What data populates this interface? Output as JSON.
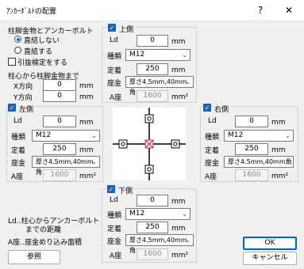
{
  "window": {
    "title": "ｱﾝｶｰﾎﾞﾙﾄの配置",
    "help": "?",
    "close": "✕"
  },
  "left_panel": {
    "column_title": "柱脚金物とアンカーボルト",
    "radio_no_connect": "直結しない",
    "radio_connect": "直結する",
    "pullout_label": "引抜検定をする",
    "distance_title": "柱心から柱脚金物まで",
    "x_label": "X方向",
    "x_value": "0",
    "x_unit": "mm",
    "y_label": "Y方向",
    "y_value": "0",
    "y_unit": "mm"
  },
  "groups": {
    "top": {
      "title": "上側",
      "ld": "0",
      "type": "M12",
      "fix": "250",
      "washer": "厚さ4.5mm,40mm角",
      "area": "1600"
    },
    "left": {
      "title": "左側",
      "ld": "0",
      "type": "M12",
      "fix": "250",
      "washer": "厚さ4.5mm,40mm角",
      "area": "1600"
    },
    "right": {
      "title": "右側",
      "ld": "0",
      "type": "M12",
      "fix": "250",
      "washer": "厚さ4.5mm,40mm角",
      "area": "1600"
    },
    "bottom": {
      "title": "下側",
      "ld": "0",
      "type": "M12",
      "fix": "250",
      "washer": "厚さ4.5mm,40mm角",
      "area": "1600"
    }
  },
  "labels": {
    "ld": "Ld",
    "type": "種類",
    "fix": "定着",
    "washer": "座金",
    "area": "A座",
    "mm": "mm",
    "mm2": "mm²"
  },
  "notes": {
    "note1": "Ld‥柱心からアンカーボルト",
    "note2": "までの距離",
    "note3": "A座‥座金めり込み面積"
  },
  "buttons": {
    "ref": "参照",
    "ok": "OK",
    "cancel": "キャンセル"
  },
  "colors": {
    "accent": "#1a63b8",
    "anchor": "#b0405a"
  }
}
